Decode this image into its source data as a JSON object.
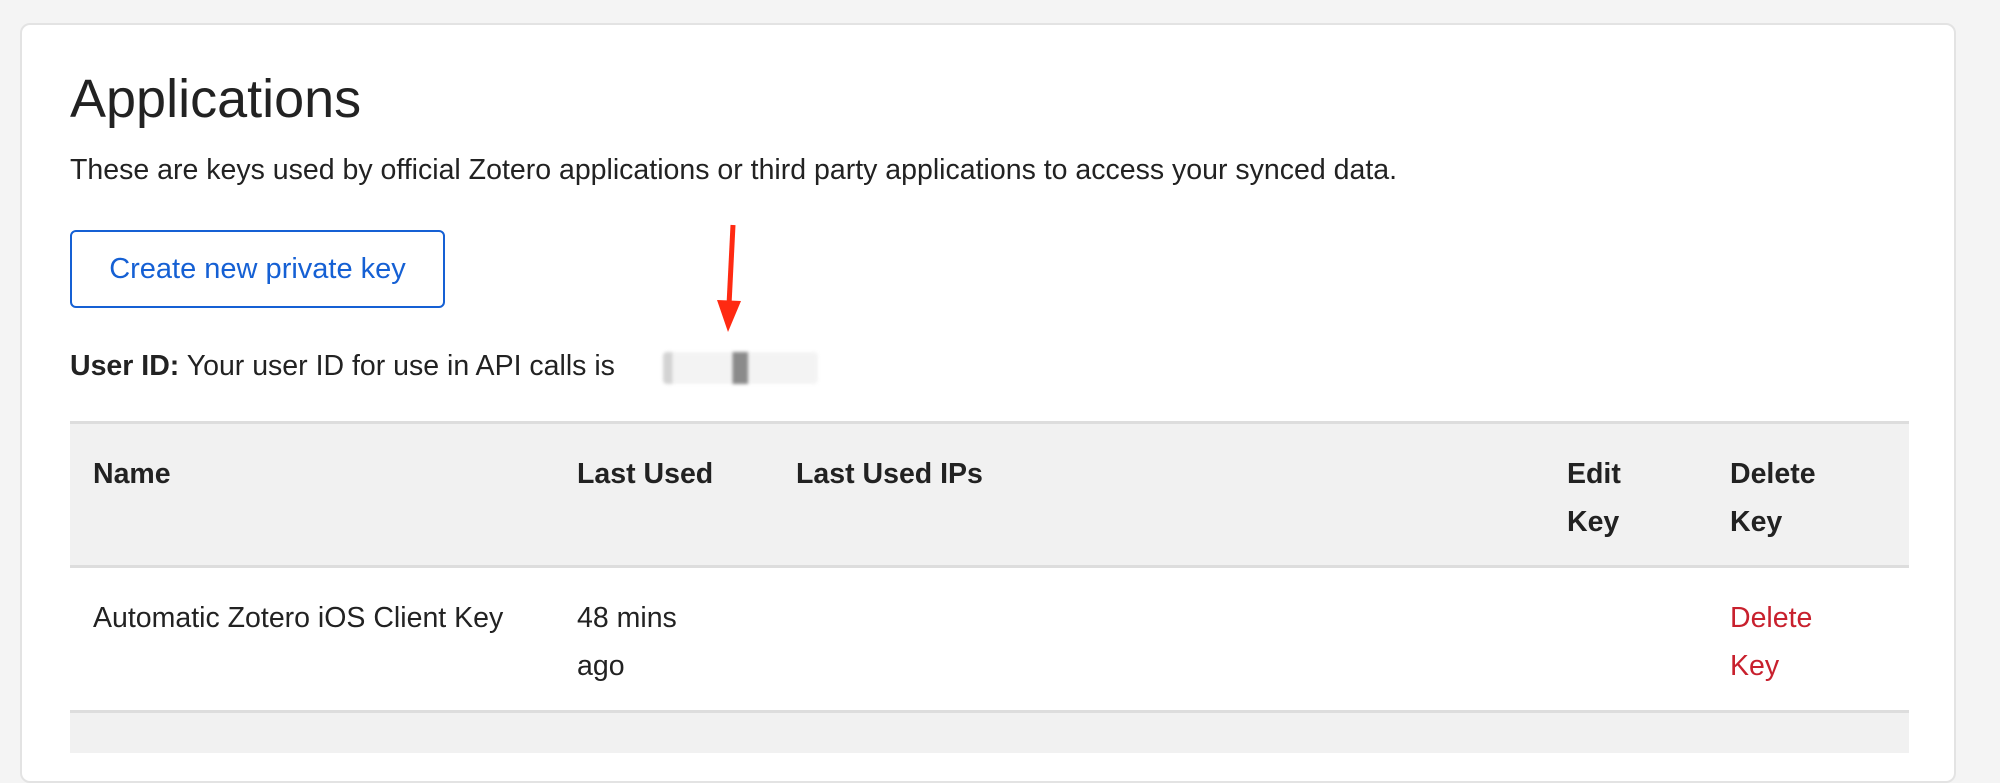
{
  "page": {
    "title": "Applications",
    "description": "These are keys used by official Zotero applications or third party applications to access your synced data.",
    "create_button": "Create new private key",
    "user_id_label": "User ID:",
    "user_id_text": "Your user ID for use in API calls is"
  },
  "table": {
    "headers": [
      "Name",
      "Last Used",
      "Last Used IPs",
      "Edit Key",
      "Delete Key"
    ],
    "rows": [
      {
        "name": "Automatic Zotero iOS Client Key",
        "last_used": "48 mins ago",
        "last_used_ips": "",
        "edit_key": "",
        "delete_key": "Delete Key"
      }
    ]
  },
  "colors": {
    "accent": "#1560d4",
    "danger": "#c8202d",
    "annotation_arrow": "#ff2a12"
  }
}
